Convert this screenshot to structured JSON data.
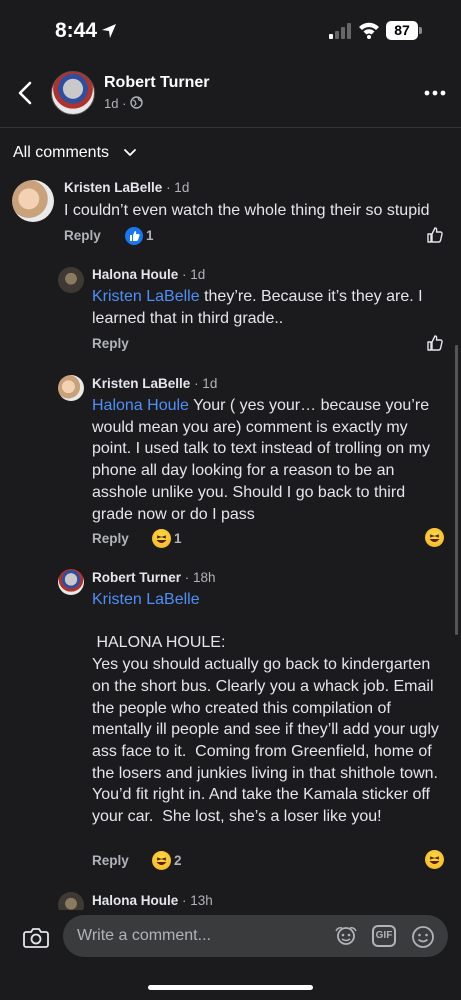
{
  "status_bar": {
    "time": "8:44",
    "battery": "87"
  },
  "header": {
    "name": "Robert Turner",
    "meta": "1d ·"
  },
  "filter": {
    "label": "All comments"
  },
  "comments": [
    {
      "author": "Kristen LaBelle",
      "ago": "· 1d",
      "mention": "",
      "text": "I couldn’t even watch the whole thing their so stupid",
      "reply": "Reply",
      "reactions": "1",
      "reaction_type": "like"
    },
    {
      "author": "Halona Houle",
      "ago": "· 1d",
      "mention": "Kristen LaBelle",
      "text": " they’re. Because it’s they are. I learned that in third grade..",
      "reply": "Reply",
      "reactions": "",
      "reaction_type": ""
    },
    {
      "author": "Kristen LaBelle",
      "ago": "· 1d",
      "mention": "Halona Houle",
      "text": " Your ( yes your… because you’re would mean you are) comment is exactly my point. I used talk to text instead of trolling on my phone all day looking for a reason to be an asshole unlike you. Should I go back to third grade now or do I pass",
      "reply": "Reply",
      "reactions": "1",
      "reaction_type": "haha"
    },
    {
      "author": "Robert Turner",
      "ago": "· 18h",
      "mention": "Kristen LaBelle",
      "text": "\n\n HALONA HOULE:\nYes you should actually go back to kindergarten on the short bus. Clearly you a whack job. Email the people who created this compilation of mentally ill people and see if they’ll add your ugly ass face to it.  Coming from Greenfield, home of the losers and junkies living in that shithole town. You’d fit right in. And take the Kamala sticker off your car.  She lost, she’s a loser like you!",
      "reply": "Reply",
      "reactions": "2",
      "reaction_type": "haha"
    },
    {
      "author": "Halona Houle",
      "ago": "· 13h"
    }
  ],
  "composer": {
    "placeholder": "Write a comment...",
    "gif_label": "GIF"
  },
  "colors": {
    "background": "#1b1b1d",
    "mention": "#4e8ff8",
    "like": "#1877f2"
  },
  "icons": [
    "location-arrow-icon",
    "signal-icon",
    "wifi-icon",
    "battery-icon",
    "back-chevron-icon",
    "globe-icon",
    "more-icon",
    "chevron-down-icon",
    "like-icon",
    "haha-icon",
    "camera-icon",
    "avatar-sticker-icon",
    "gif-icon",
    "smiley-icon"
  ]
}
